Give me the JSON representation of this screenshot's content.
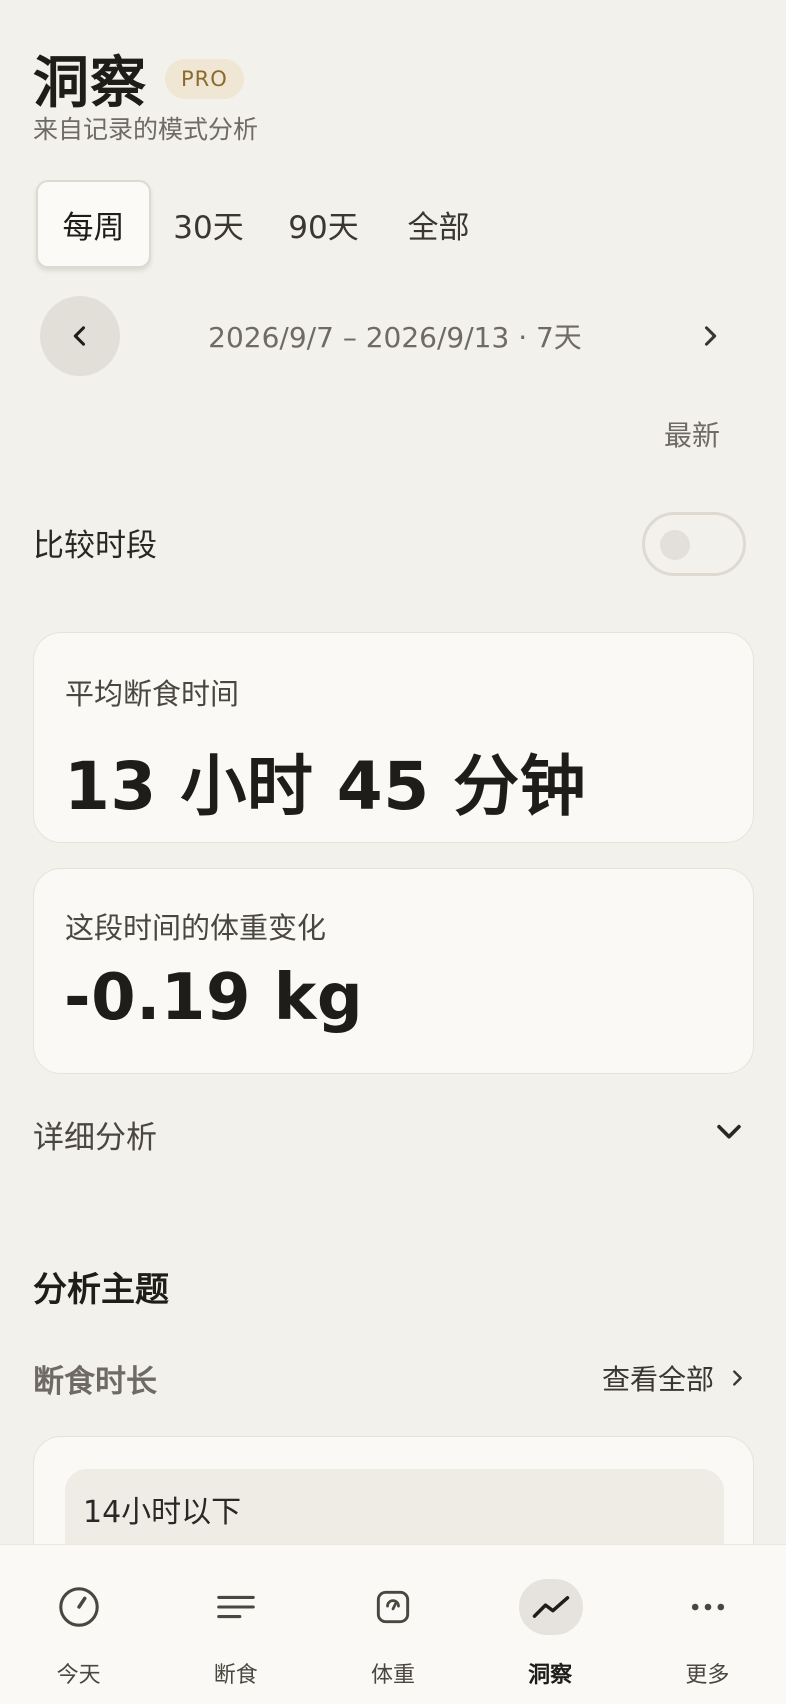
{
  "header": {
    "title": "洞察",
    "badge": "PRO",
    "subtitle": "来自记录的模式分析"
  },
  "period_tabs": {
    "items": [
      "每周",
      "30天",
      "90天",
      "全部"
    ],
    "selected": "每周"
  },
  "date_nav": {
    "range": "2026/9/7 – 2026/9/13 · 7天",
    "latest_label": "最新"
  },
  "compare": {
    "label": "比较时段",
    "enabled": false
  },
  "avg_fasting": {
    "label": "平均断食时间",
    "value": "13 小时 45 分钟"
  },
  "weight_change": {
    "label": "这段时间的体重变化",
    "value": "-0.19 kg"
  },
  "detail": {
    "label": "详细分析"
  },
  "topics": {
    "title": "分析主题",
    "section": "断食时长",
    "view_all": "查看全部",
    "first_item": "14小时以下"
  },
  "bottom_nav": {
    "items": [
      {
        "label": "今天",
        "icon": "clock-icon"
      },
      {
        "label": "断食",
        "icon": "lines-icon"
      },
      {
        "label": "体重",
        "icon": "scale-icon"
      },
      {
        "label": "洞察",
        "icon": "trend-icon"
      },
      {
        "label": "更多",
        "icon": "more-icon"
      }
    ],
    "active": "洞察"
  },
  "colors": {
    "background": "#f3f1ec",
    "card": "#faf9f5",
    "badge_bg": "#efe6d4",
    "badge_text": "#8a6a2e"
  }
}
